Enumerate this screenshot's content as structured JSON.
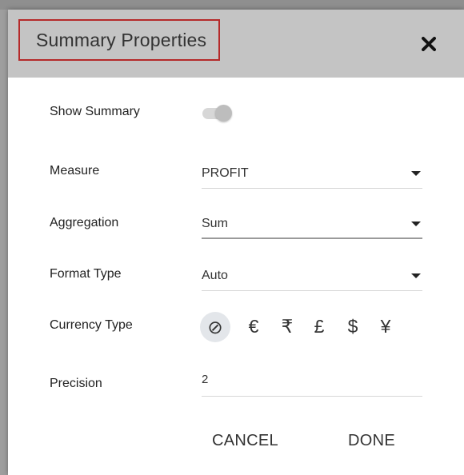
{
  "dialog": {
    "title": "Summary Properties",
    "close_icon": "close-icon"
  },
  "fields": {
    "show_summary": {
      "label": "Show Summary",
      "enabled": false
    },
    "measure": {
      "label": "Measure",
      "value": "PROFIT"
    },
    "aggregation": {
      "label": "Aggregation",
      "value": "Sum"
    },
    "format_type": {
      "label": "Format Type",
      "value": "Auto"
    },
    "currency_type": {
      "label": "Currency Type",
      "options": [
        "⊘",
        "€",
        "₹",
        "£",
        "$",
        "¥"
      ],
      "selected": "⊘"
    },
    "precision": {
      "label": "Precision",
      "value": "2"
    }
  },
  "actions": {
    "cancel_label": "CANCEL",
    "done_label": "DONE"
  }
}
